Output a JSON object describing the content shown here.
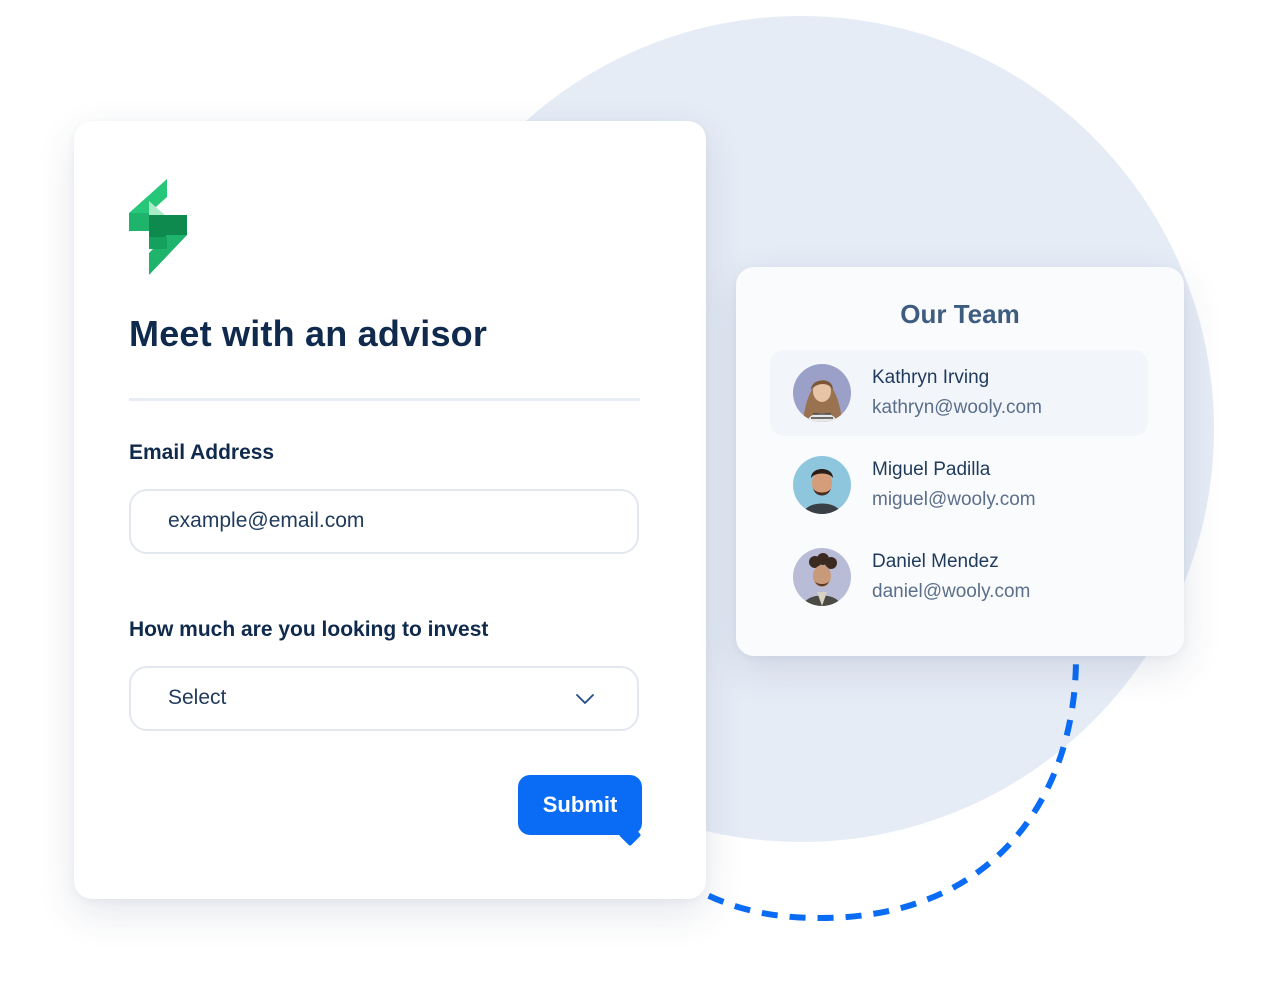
{
  "form": {
    "title": "Meet with an advisor",
    "email_label": "Email Address",
    "email_placeholder": "example@email.com",
    "invest_label": "How much are you looking to invest",
    "select_value": "Select",
    "submit_label": "Submit"
  },
  "team": {
    "title": "Our Team",
    "members": [
      {
        "name": "Kathryn Irving",
        "email": "kathryn@wooly.com"
      },
      {
        "name": "Miguel Padilla",
        "email": "miguel@wooly.com"
      },
      {
        "name": "Daniel Mendez",
        "email": "daniel@wooly.com"
      }
    ]
  },
  "colors": {
    "accent": "#0a6cf5",
    "heading": "#0f2a4d",
    "logo_green": "#1fb46b",
    "background_circle": "#e6ecf6"
  },
  "icons": {
    "logo": "logo-icon",
    "select_arrow": "chevron-down-icon"
  }
}
